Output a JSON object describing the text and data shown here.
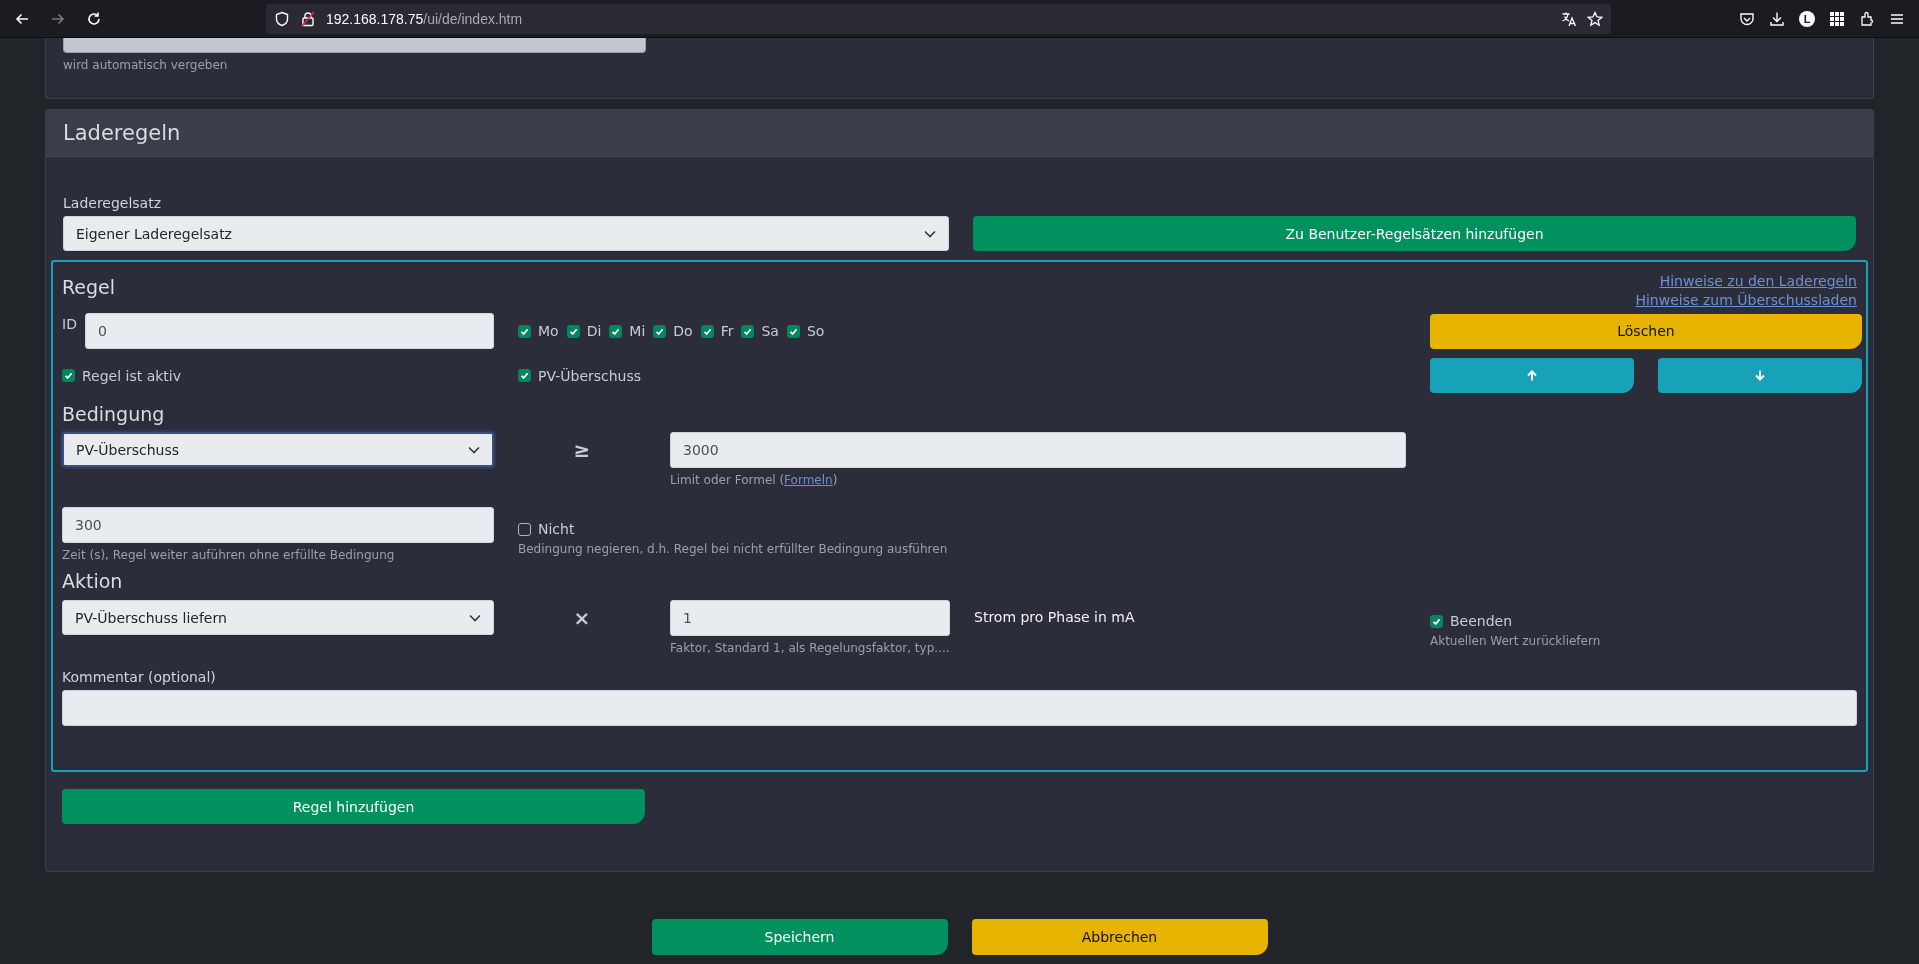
{
  "browser": {
    "url_host": "192.168.178.75",
    "url_path": "/ui/de/index.htm",
    "profile_initial": "L"
  },
  "top_card": {
    "field_hint": "wird automatisch vergeben"
  },
  "section": {
    "title": "Laderegeln",
    "ruleset_label": "Laderegelsatz",
    "ruleset_value": "Eigener Laderegelsatz",
    "add_ruleset_button": "Zu Benutzer-Regelsätzen hinzufügen",
    "rule": {
      "title": "Regel",
      "links": [
        "Hinweise zu den Laderegeln",
        "Hinweise zum Überschussladen"
      ],
      "id_label": "ID",
      "id_value": "0",
      "days": [
        {
          "label": "Mo",
          "checked": true
        },
        {
          "label": "Di",
          "checked": true
        },
        {
          "label": "Mi",
          "checked": true
        },
        {
          "label": "Do",
          "checked": true
        },
        {
          "label": "Fr",
          "checked": true
        },
        {
          "label": "Sa",
          "checked": true
        },
        {
          "label": "So",
          "checked": true
        }
      ],
      "active": {
        "label": "Regel ist aktiv",
        "checked": true
      },
      "pv_surplus": {
        "label": "PV-Überschuss",
        "checked": true
      },
      "delete_button": "Löschen",
      "move_buttons": [
        {
          "kind": "up"
        },
        {
          "kind": "down"
        }
      ],
      "condition": {
        "title": "Bedingung",
        "select": "PV-Überschuss",
        "focused": true,
        "operator": "≥",
        "limit": "3000",
        "limit_hint_before": "Limit oder Formel (",
        "limit_hint_link": "Formeln",
        "limit_hint_after": ")",
        "time": "300",
        "time_hint": "Zeit (s), Regel weiter auführen ohne erfüllte Bedingung",
        "negate": {
          "label": "Nicht",
          "checked": false
        },
        "negate_hint": "Bedingung negieren, d.h. Regel bei nicht erfüllter Bedingung ausführen"
      },
      "action": {
        "title": "Aktion",
        "select": "PV-Überschuss liefern",
        "operator": "×",
        "factor": "1",
        "factor_hint": "Faktor, Standard 1, als Regelungsfaktor, typ....",
        "unit": "Strom pro Phase in mA",
        "finish": {
          "label": "Beenden",
          "checked": true
        },
        "finish_hint": "Aktuellen Wert zurückliefern"
      },
      "comment_label": "Kommentar (optional)"
    },
    "add_rule_button": "Regel hinzufügen"
  },
  "footer_buttons": [
    {
      "label": "Speichern",
      "kind": "primary"
    },
    {
      "label": "Abbrechen",
      "kind": "warning"
    }
  ]
}
